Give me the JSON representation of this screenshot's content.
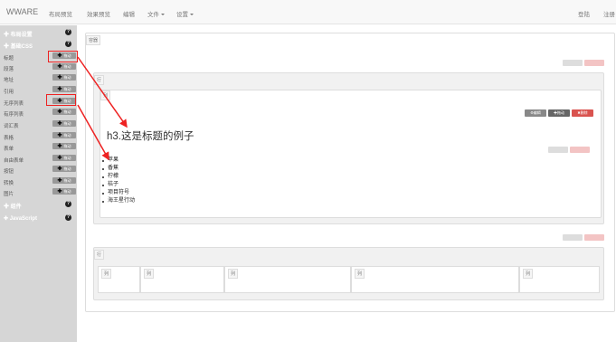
{
  "topbar": {
    "brand": "WWARE",
    "menu": [
      {
        "label": "布局预览",
        "caret": false
      },
      {
        "label": "效果预览",
        "caret": false
      },
      {
        "label": "编辑",
        "caret": false
      },
      {
        "label": "文件",
        "caret": true
      },
      {
        "label": "设置",
        "caret": true
      }
    ],
    "login": "登陆",
    "register": "注册"
  },
  "sidebar": {
    "sections": [
      {
        "label": "布局设置",
        "icon": "question-circle-icon"
      },
      {
        "label": "基础CSS",
        "icon": "question-circle-icon"
      },
      {
        "label": "组件",
        "icon": "question-circle-icon"
      },
      {
        "label": "JavaScript",
        "icon": "question-circle-icon"
      }
    ],
    "items": [
      {
        "label": "标题",
        "button": "拖动"
      },
      {
        "label": "段落",
        "button": "拖动"
      },
      {
        "label": "地址",
        "button": "拖动"
      },
      {
        "label": "引用",
        "button": "拖动"
      },
      {
        "label": "无序列表",
        "button": "拖动"
      },
      {
        "label": "有序列表",
        "button": "拖动"
      },
      {
        "label": "词汇表",
        "button": "拖动"
      },
      {
        "label": "表格",
        "button": "拖动"
      },
      {
        "label": "表单",
        "button": "拖动"
      },
      {
        "label": "自由表单",
        "button": "拖动"
      },
      {
        "label": "按钮",
        "button": "拖动"
      },
      {
        "label": "转换",
        "button": "拖动"
      },
      {
        "label": "图片",
        "button": "拖动"
      }
    ]
  },
  "canvas": {
    "container_tag": "容器",
    "row_tag": "行",
    "col_tag": "列",
    "edit_label": "编辑",
    "drag_label": "拖动",
    "delete_label": "删除",
    "heading": "h3.这是标题的例子",
    "list_items": [
      "苹果",
      "香蕉",
      "柠檬",
      "桔子",
      "项目符号",
      "海王星行动"
    ]
  },
  "colors": {
    "highlight": "#ee2222",
    "sidebar_bg": "#d6d6d6",
    "delete_btn": "#d9534f"
  }
}
